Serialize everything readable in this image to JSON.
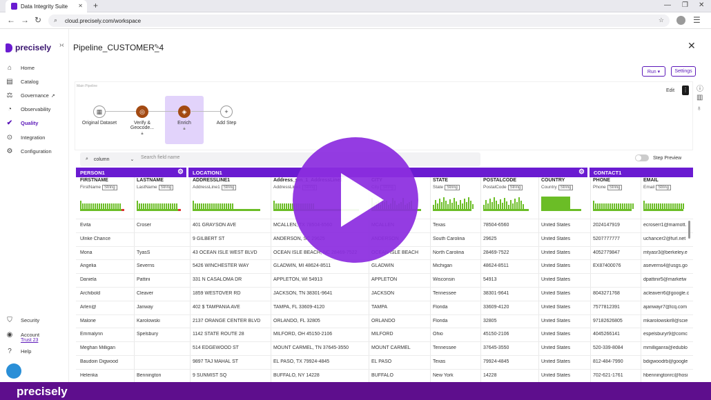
{
  "browser": {
    "tab_title": "Data Integrity Suite",
    "url": "cloud.precisely.com/workspace"
  },
  "sidebar": {
    "logo_text": "precisely",
    "items": [
      {
        "label": "Home",
        "icon": "home-icon"
      },
      {
        "label": "Catalog",
        "icon": "catalog-icon"
      },
      {
        "label": "Governance",
        "icon": "governance-icon"
      },
      {
        "label": "Observability",
        "icon": "observability-icon"
      },
      {
        "label": "Quality",
        "icon": "quality-icon"
      },
      {
        "label": "Integration",
        "icon": "integration-icon"
      },
      {
        "label": "Configuration",
        "icon": "configuration-icon"
      }
    ],
    "bottom": [
      {
        "label": "Security",
        "icon": "shield-icon"
      },
      {
        "label": "Account",
        "icon": "account-icon"
      },
      {
        "label": "Help",
        "icon": "help-icon"
      }
    ],
    "account_sub": "Trust 23"
  },
  "header": {
    "title": "Pipeline_CUSTOMER_4",
    "run_label": "Run ▾",
    "settings_label": "Settings"
  },
  "canvas": {
    "label": "Main Pipeline",
    "edit_label": "Edit",
    "steps": [
      {
        "label": "Original Dataset"
      },
      {
        "label": "Verify & Geocode..."
      },
      {
        "label": "Enrich"
      },
      {
        "label": "Add Step"
      }
    ]
  },
  "search": {
    "column_select": "column",
    "placeholder": "Search field name",
    "step_preview": "Step Preview"
  },
  "groups": [
    "PERSON1",
    "LOCATION1",
    "CONTACT1"
  ],
  "columns": [
    {
      "name": "FIRSTNAME",
      "sub": "FirstName",
      "type": "String"
    },
    {
      "name": "LASTNAME",
      "sub": "LastName",
      "type": "String"
    },
    {
      "name": "ADDRESSLINE1",
      "sub": "AddressLine1",
      "type": "String"
    },
    {
      "name": "Address_pin_1_AddressLine1",
      "sub": "AddressLine1",
      "type": "String"
    },
    {
      "name": "CITY",
      "sub": "City",
      "type": "String"
    },
    {
      "name": "STATE",
      "sub": "State",
      "type": "String"
    },
    {
      "name": "POSTALCODE",
      "sub": "PostalCode",
      "type": "String"
    },
    {
      "name": "COUNTRY",
      "sub": "Country",
      "type": "String"
    },
    {
      "name": "PHONE",
      "sub": "Phone",
      "type": "String"
    },
    {
      "name": "EMAIL",
      "sub": "Email",
      "type": "String"
    }
  ],
  "rows": [
    [
      "Evita",
      "Croser",
      "401 GRAYSON AVE",
      "MCALLEN, TX 78504-6560",
      "MCALLEN",
      "Texas",
      "78504-6560",
      "United States",
      "2024147919",
      "ecroserr1@marriott."
    ],
    [
      "Ulrike Chance",
      "",
      "9 GILBERT ST",
      "ANDERSON, SC 29625",
      "ANDERSON",
      "South Carolina",
      "29625",
      "United States",
      "5207777777",
      "uchancer2@furl.net"
    ],
    [
      "Mona",
      "TyasS",
      "43 OCEAN ISLE WEST BLVD",
      "OCEAN ISLE BEACH, NC 28469-7522",
      "OCEAN ISLE BEACH",
      "North Carolina",
      "28469-7522",
      "United States",
      "4052779847",
      "mtyasr3@berkeley.e"
    ],
    [
      "Angelia",
      "Severns",
      "5426 WINCHESTER WAY",
      "GLADWIN, MI 48624-8511",
      "GLADWIN",
      "Michigan",
      "48624-8511",
      "United States",
      "EX87400076",
      "aseverns4@usgs.go"
    ],
    [
      "Daniela",
      "Pattini",
      "331 N CASALOMA DR",
      "APPLETON, WI 54913",
      "APPLETON",
      "Wisconsin",
      "54913",
      "United States",
      "",
      "dpattinir5@marketw"
    ],
    [
      "Archibold",
      "Cleaver",
      "1859 WESTOVER RD",
      "JACKSON, TN 38301-9641",
      "JACKSON",
      "Tennessee",
      "38301-9641",
      "United States",
      "8043271768",
      "acleaverr6@google.c"
    ],
    [
      "Arlen@",
      "Janway",
      "402 $ TAMPANIA AVE",
      "TAMPA, FL 33609-4120",
      "TAMPA",
      "Florida",
      "33609-4120",
      "United States",
      "7577812391",
      "ajanwayr7@lcq.com"
    ],
    [
      "Malorie",
      "Karolowski",
      "2137 ORANGE CENTER BLVD",
      "ORLANDO, FL 32805",
      "ORLANDO",
      "Florida",
      "32805",
      "United States",
      "97182626805",
      "mkarolowskir8@scie"
    ],
    [
      "Emmalynn",
      "Spelsbury",
      "1142 STATE ROUTE 28",
      "MILFORD, OH 45150-2106",
      "MILFORD",
      "Ohio",
      "45150-2106",
      "United States",
      "4045266141",
      "espelsburyr9@comc"
    ],
    [
      "Meghan Milligan",
      "",
      "514 EDGEWOOD ST",
      "MOUNT CARMEL, TN 37645-3550",
      "MOUNT CARMEL",
      "Tennessee",
      "37645-3550",
      "United States",
      "520-339-8084",
      "mmilliganra@edublo"
    ],
    [
      "Baudoin Digwood",
      "",
      "9897 TAJ MAHAL ST",
      "EL PASO, TX 79924-4845",
      "EL PASO",
      "Texas",
      "79924-4845",
      "United States",
      "812-484-7990",
      "bdigwoodrb@google"
    ],
    [
      "Helenka",
      "Bennington",
      "9 SUNMIST SQ",
      "BUFFALO, NY 14228",
      "BUFFALO",
      "New York",
      "14228",
      "United States",
      "702-621-1761",
      "hbenningtonrc@hosi"
    ]
  ],
  "footer": {
    "logo_text": "precisely"
  },
  "colors": {
    "brand": "#6a1bd1",
    "accent_green": "#6bbd26",
    "footer": "#5e0e8d"
  }
}
